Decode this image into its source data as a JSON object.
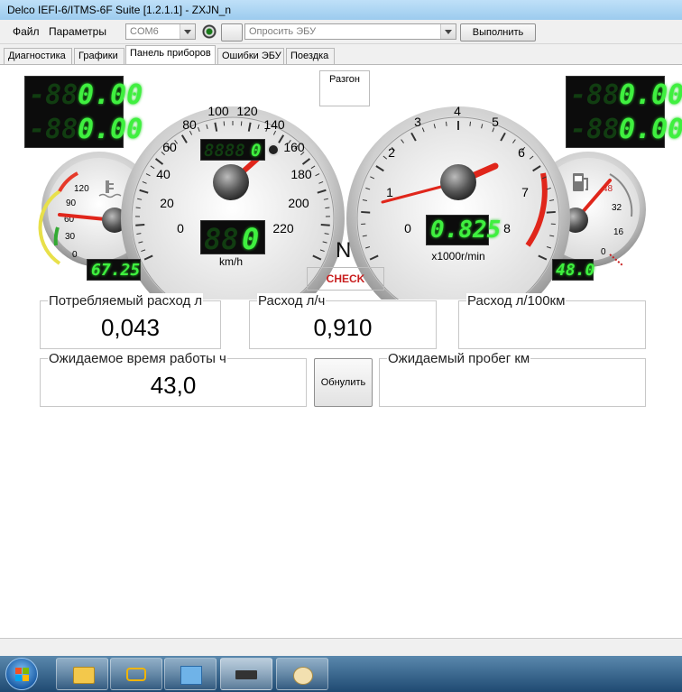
{
  "window": {
    "title": "Delco IEFI-6/ITMS-6F Suite [1.2.1.1] - ZXJN_n"
  },
  "menu": {
    "file": "Файл",
    "params": "Параметры"
  },
  "toolbar": {
    "port": "COM6",
    "poll_select": "Опросить ЭБУ",
    "execute_button": "Выполнить"
  },
  "tabs": [
    "Диагностика",
    "Графики",
    "Панель приборов",
    "Ошибки ЭБУ",
    "Поездка"
  ],
  "active_tab": 2,
  "dashboard": {
    "left_lcd": [
      "0.00",
      "0.00"
    ],
    "right_lcd": [
      "0.00",
      "0.00"
    ],
    "razgon_label": "Разгон",
    "gear": "N",
    "check_label": "CHECK",
    "speedometer": {
      "ticks": [
        "0",
        "20",
        "40",
        "60",
        "80",
        "100",
        "120",
        "140",
        "160",
        "180",
        "200",
        "220"
      ],
      "unit": "km/h",
      "speed_value": "0",
      "odo_value": "0"
    },
    "tachometer": {
      "ticks": [
        "0",
        "1",
        "2",
        "3",
        "4",
        "5",
        "6",
        "7",
        "8"
      ],
      "unit": "x1000r/min",
      "rpm_value": "0.825"
    },
    "temp_gauge": {
      "ticks": [
        "0",
        "30",
        "60",
        "90",
        "120"
      ],
      "value": "67.25"
    },
    "fuel_gauge": {
      "ticks": [
        "0",
        "16",
        "32",
        "48"
      ],
      "value": "48.0"
    }
  },
  "readouts": {
    "consumed": {
      "label": "Потребляемый расход л",
      "value": "0,043"
    },
    "per_hour": {
      "label": "Расход л/ч",
      "value": "0,910"
    },
    "per_100km": {
      "label": "Расход л/100км",
      "value": ""
    },
    "expected_time": {
      "label": "Ожидаемое время работы ч",
      "value": "43,0"
    },
    "reset_button": "Обнулить",
    "expected_mileage": {
      "label": "Ожидаемый пробег км",
      "value": ""
    }
  },
  "colors": {
    "lcd_green": "#3ff03f",
    "needle_red": "#e0261b",
    "check_red": "#c81e1e"
  }
}
